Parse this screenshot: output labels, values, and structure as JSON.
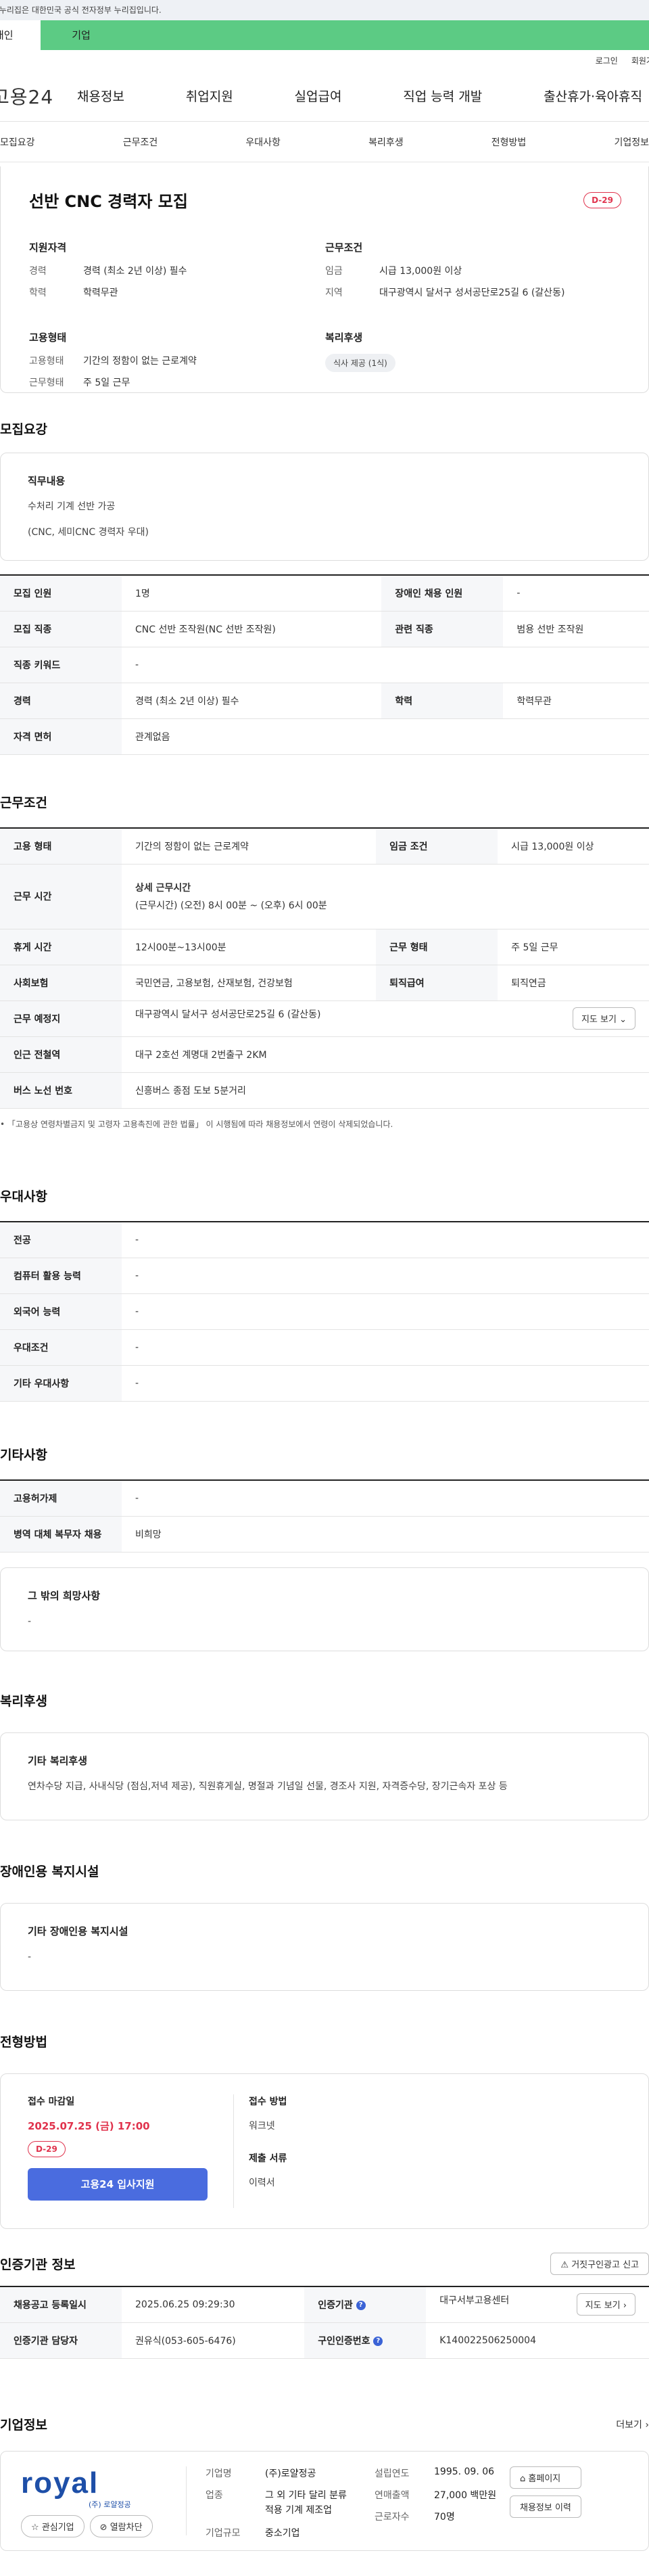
{
  "topbar": {
    "notice": "이 누리집은 대한민국 공식 전자정부 누리집입니다."
  },
  "site_tabs": [
    {
      "label": "개인"
    },
    {
      "label": "기업"
    }
  ],
  "util": {
    "login": "로그인",
    "join": "회원가입"
  },
  "gnb": {
    "logo": "고용24",
    "menu": [
      "채용정보",
      "취업지원",
      "실업급여",
      "직업 능력 개발",
      "출산휴가·육아휴직"
    ]
  },
  "subtabs": [
    "모집요강",
    "근무조건",
    "우대사항",
    "복리후생",
    "전형방법",
    "기업정보"
  ],
  "summary": {
    "title": "선반 CNC 경력자 모집",
    "dday": "D-29",
    "qual_title": "지원자격",
    "qual": [
      {
        "k": "경력",
        "v": "경력 (최소 2년 이상) 필수"
      },
      {
        "k": "학력",
        "v": "학력무관"
      }
    ],
    "cond_title": "근무조건",
    "cond": [
      {
        "k": "임금",
        "v": "시급 13,000원 이상"
      },
      {
        "k": "지역",
        "v": "대구광역시 달서구 성서공단로25길 6 (갈산동)"
      }
    ],
    "emp_title": "고용형태",
    "emp": [
      {
        "k": "고용형태",
        "v": "기간의 정함이 없는 근로계약"
      },
      {
        "k": "근무형태",
        "v": "주 5일 근무"
      }
    ],
    "welfare_title": "복리후생",
    "welfare_chip": "식사 제공 (1식)"
  },
  "recruit": {
    "title": "모집요강",
    "duty_title": "직무내용",
    "duty_lines": [
      "수처리 기계 선반 가공",
      "(CNC, 세미CNC 경력자 우대)"
    ],
    "rows": [
      {
        "k1": "모집 인원",
        "v1": "1명",
        "k2": "장애인 채용 인원",
        "v2": "-"
      },
      {
        "k1": "모집 직종",
        "v1": "CNC 선반 조작원(NC 선반 조작원)",
        "k2": "관련 직종",
        "v2": "범용 선반 조작원"
      },
      {
        "k1": "직종 키워드",
        "v1": "-"
      },
      {
        "k1": "경력",
        "v1": "경력 (최소 2년 이상) 필수",
        "k2": "학력",
        "v2": "학력무관"
      },
      {
        "k1": "자격 면허",
        "v1": "관계없음"
      }
    ]
  },
  "work": {
    "title": "근무조건",
    "emp_k": "고용 형태",
    "emp_v": "기간의 정함이 없는 근로계약",
    "wage_k": "임금 조건",
    "wage_v": "시급 13,000원 이상",
    "time_k": "근무 시간",
    "time_title": "상세 근무시간",
    "time_v": "(근무시간) (오전) 8시 00분 ~ (오후) 6시 00분",
    "rest_k": "휴게 시간",
    "rest_v": "12시00분~13시00분",
    "form_k": "근무 형태",
    "form_v": "주 5일 근무",
    "ins_k": "사회보험",
    "ins_v": "국민연금, 고용보험, 산재보험, 건강보험",
    "ret_k": "퇴직급여",
    "ret_v": "퇴직연금",
    "place_k": "근무 예정지",
    "place_v": "대구광역시 달서구 성서공단로25길 6 (갈산동)",
    "map_btn": "지도 보기",
    "subway_k": "인근 전철역",
    "subway_v": "대구 2호선 계명대 2번출구 2KM",
    "bus_k": "버스 노선 번호",
    "bus_v": "신흥버스 종점 도보 5분거리",
    "note": "「고용상 연령차별금지 및 고령자 고용촉진에 관한 법률」 이 시행됨에 따라 채용정보에서 연령이 삭제되었습니다."
  },
  "pref": {
    "title": "우대사항",
    "rows": [
      {
        "k": "전공",
        "v": "-"
      },
      {
        "k": "컴퓨터 활용 능력",
        "v": "-"
      },
      {
        "k": "외국어 능력",
        "v": "-"
      },
      {
        "k": "우대조건",
        "v": "-"
      },
      {
        "k": "기타 우대사항",
        "v": "-"
      }
    ]
  },
  "etc": {
    "title": "기타사항",
    "rows": [
      {
        "k": "고용허가제",
        "v": "-"
      },
      {
        "k": "병역 대체 복무자 채용",
        "v": "비희망"
      }
    ],
    "other_title": "그 밖의 희망사항",
    "other_v": "-"
  },
  "benefit": {
    "title": "복리후생",
    "box_title": "기타 복리후생",
    "box_v": "연차수당 지급, 사내식당 (점심,저녁 제공), 직원휴게실, 명절과 기념일 선물, 경조사 지원, 자격증수당, 장기근속자 포상 등"
  },
  "disabled": {
    "title": "장애인용 복지시설",
    "box_title": "기타 장애인용 복지시설",
    "box_v": "-"
  },
  "process": {
    "title": "전형방법",
    "deadline_label": "접수 마감일",
    "deadline": "2025.07.25 (금) 17:00",
    "dday": "D-29",
    "apply_btn": "고용24 입사지원",
    "method_label": "접수 방법",
    "method": "워크넷",
    "docs_label": "제출 서류",
    "docs": "이력서"
  },
  "agency": {
    "title": "인증기관 정보",
    "report_btn": "거짓구인광고 신고",
    "reg_k": "채용공고 등록일시",
    "reg_v": "2025.06.25 09:29:30",
    "org_k": "인증기관",
    "org_v": "대구서부고용센터",
    "map_btn": "지도 보기",
    "mgr_k": "인증기관 담당자",
    "mgr_v": "권유식(053-605-6476)",
    "num_k": "구인인증번호",
    "num_v": "K140022506250004"
  },
  "company": {
    "title": "기업정보",
    "more": "더보기",
    "logo_text": "royal",
    "logo_sub": "(주) 로얄정공",
    "interest_btn": "관심기업",
    "block_btn": "열람차단",
    "name_k": "기업명",
    "name_v": "(주)로얄정공",
    "ind_k": "업종",
    "ind_v": "그 외 기타 달리 분류되지 않은 특수 목적용 기계 제조업",
    "ind_v1": "그 외 기타 달리 분류",
    "ind_v2": "적용 기계 제조업",
    "size_k": "기업규모",
    "size_v": "중소기업",
    "year_k": "설립연도",
    "year_v": "1995. 09. 06",
    "sales_k": "연매출액",
    "sales_v": "27,000 백만원",
    "emp_k": "근로자수",
    "emp_v": "70명",
    "home_btn": "홈페이지",
    "jobs_btn": "채용정보 이력"
  }
}
